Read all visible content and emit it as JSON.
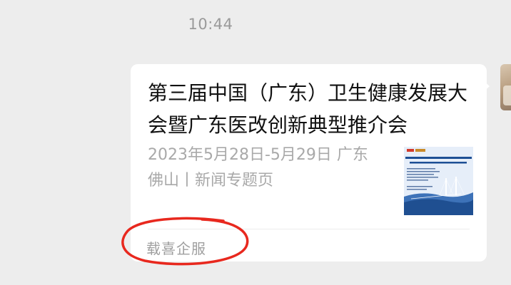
{
  "chat": {
    "timestamp": "10:44"
  },
  "article_card": {
    "title": "第三届中国（广东）卫生健康发展大会暨广东医改创新典型推介会",
    "description": "2023年5月28日-5月29日 广东 佛山丨新闻专题页",
    "thumbnail": "thumbnail-poster-image",
    "source": "载喜企服"
  },
  "annotation": {
    "color": "#e8281e"
  },
  "colors": {
    "background": "#ededed",
    "card": "#ffffff",
    "title": "#111111",
    "muted": "#a9a9a9"
  }
}
